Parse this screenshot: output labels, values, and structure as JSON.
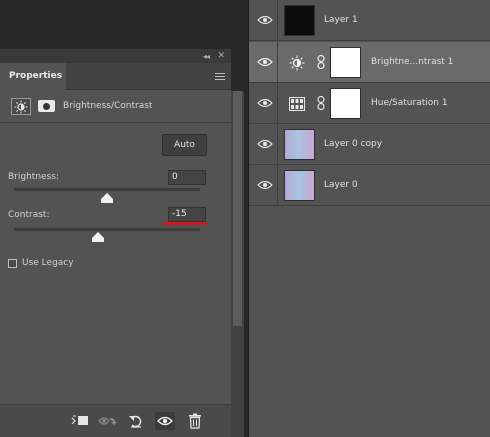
{
  "properties": {
    "tab_label": "Properties",
    "collapse_glyph": "◂◂",
    "close_glyph": "✕",
    "adjustment_title": "Brightness/Contrast",
    "auto_button": "Auto",
    "brightness_label": "Brightness:",
    "brightness_value": "0",
    "brightness_level": 0,
    "contrast_label": "Contrast:",
    "contrast_value": "-15",
    "contrast_level": -15,
    "slider_range": [
      -150,
      150
    ],
    "use_legacy_label": "Use Legacy",
    "use_legacy_checked": false,
    "highlight_color": "#d5161a",
    "bottom_icons": [
      "clip-to-layer-icon",
      "view-previous-state-icon",
      "reset-icon",
      "visibility-eye-icon",
      "trash-icon"
    ]
  },
  "layers": {
    "items": [
      {
        "name": "Layer 1",
        "visible": true,
        "thumbnail": "black",
        "type": "pixel",
        "selected": false
      },
      {
        "name": "Brightne...ntrast 1",
        "visible": true,
        "thumbnail": "white",
        "type": "brightness-contrast",
        "selected": true
      },
      {
        "name": "Hue/Saturation 1",
        "visible": true,
        "thumbnail": "white",
        "type": "hue-saturation",
        "selected": false
      },
      {
        "name": "Layer 0 copy",
        "visible": true,
        "thumbnail": "gradient",
        "type": "pixel",
        "selected": false
      },
      {
        "name": "Layer 0",
        "visible": true,
        "thumbnail": "gradient",
        "type": "pixel",
        "selected": false
      }
    ]
  }
}
